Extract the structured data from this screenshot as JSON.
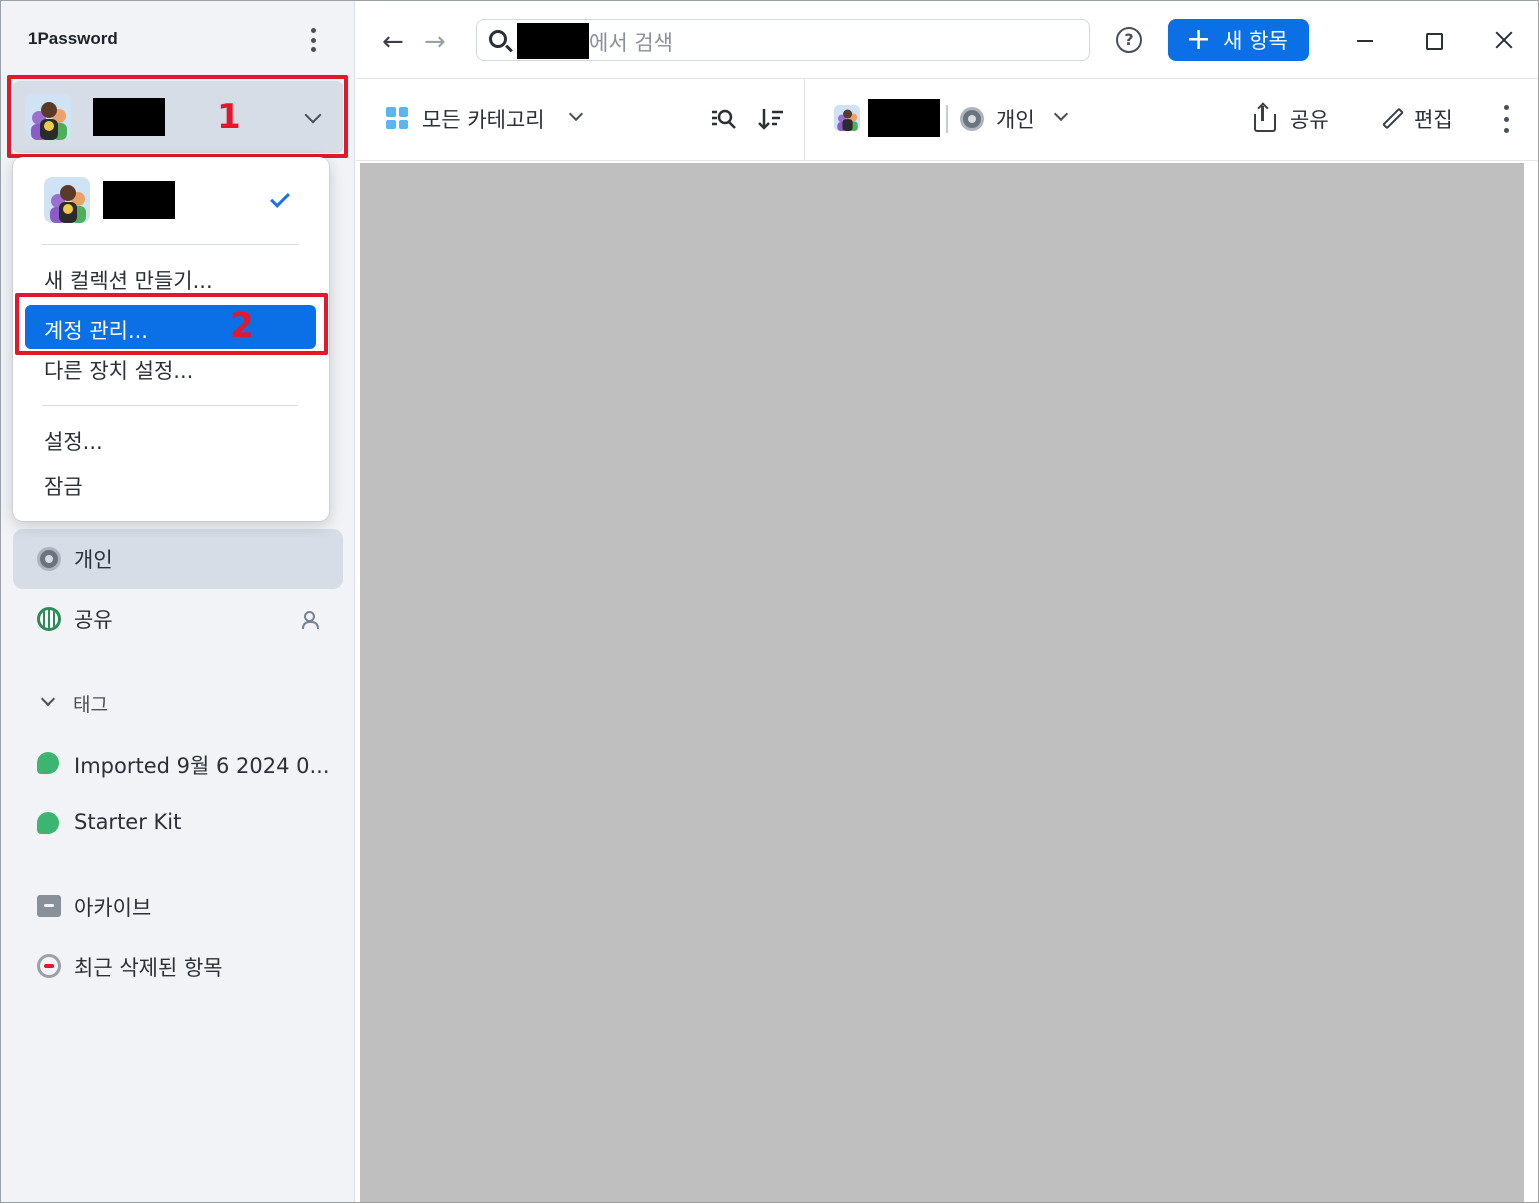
{
  "app": {
    "title": "1Password"
  },
  "account": {
    "annotation_1": "1",
    "annotation_2": "2"
  },
  "menu": {
    "items": [
      {
        "label": "새 컬렉션 만들기..."
      },
      {
        "label": "계정 관리..."
      },
      {
        "label": "다른 장치 설정..."
      },
      {
        "label": "설정..."
      },
      {
        "label": "잠금"
      }
    ]
  },
  "sidebar": {
    "vaults": [
      {
        "label": "개인",
        "icon": "vault-icon"
      },
      {
        "label": "공유",
        "icon": "shared-vault-icon"
      }
    ],
    "tags_header": "태그",
    "tags": [
      {
        "label": "Imported 9월 6 2024 0..."
      },
      {
        "label": "Starter Kit"
      }
    ],
    "archive": "아카이브",
    "recently_deleted": "최근 삭제된 항목"
  },
  "toolbar": {
    "back_icon": "←",
    "forward_icon": "→",
    "search_placeholder": "에서 검색",
    "help_icon": "?",
    "new_item_label": "새 항목",
    "plus": "+"
  },
  "subbar": {
    "categories_label": "모든 카테고리",
    "vault_label": "개인",
    "share_label": "공유",
    "edit_label": "편집"
  },
  "colors": {
    "accent": "#0b6fe6",
    "annotation_red": "#e3182d",
    "sidebar_bg": "#f1f3f6",
    "content_bg": "#bfbfbf"
  }
}
